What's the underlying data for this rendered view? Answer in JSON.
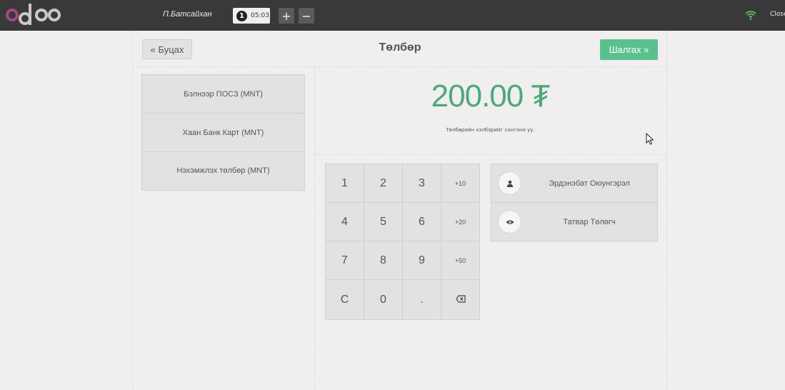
{
  "topbar": {
    "cashier": "П.Батсайхан",
    "order": {
      "number": "1",
      "time": "05:03"
    },
    "add_label": "+",
    "remove_label": "−",
    "close_label": "Close",
    "wifi_color": "#5cb85c"
  },
  "payment": {
    "back_label": "« Буцах",
    "title": "Төлбөр",
    "next_label": "Шалгах »",
    "methods": [
      {
        "label": "Бэлнээр ПОСЗ (MNT)"
      },
      {
        "label": "Хаан Банк Карт (MNT)"
      },
      {
        "label": "Нэхэмжлэх төлбөр (MNT)"
      }
    ],
    "total": "200.00 ₮",
    "hint": "Төлбөрийн хэлбэрийг сонгоно уу."
  },
  "numpad": {
    "keys": [
      "1",
      "2",
      "3",
      "+10",
      "4",
      "5",
      "6",
      "+20",
      "7",
      "8",
      "9",
      "+50",
      "C",
      "0",
      ".",
      "⌫"
    ]
  },
  "actions": {
    "customer_label": "Эрдэнэбат Оюунгэрэл",
    "taxpayer_label": "Татвар Төлөгч"
  },
  "colors": {
    "accent": "#5ac18e",
    "total": "#4da87b",
    "topbar": "#393939",
    "logo_pink": "#a24689"
  }
}
